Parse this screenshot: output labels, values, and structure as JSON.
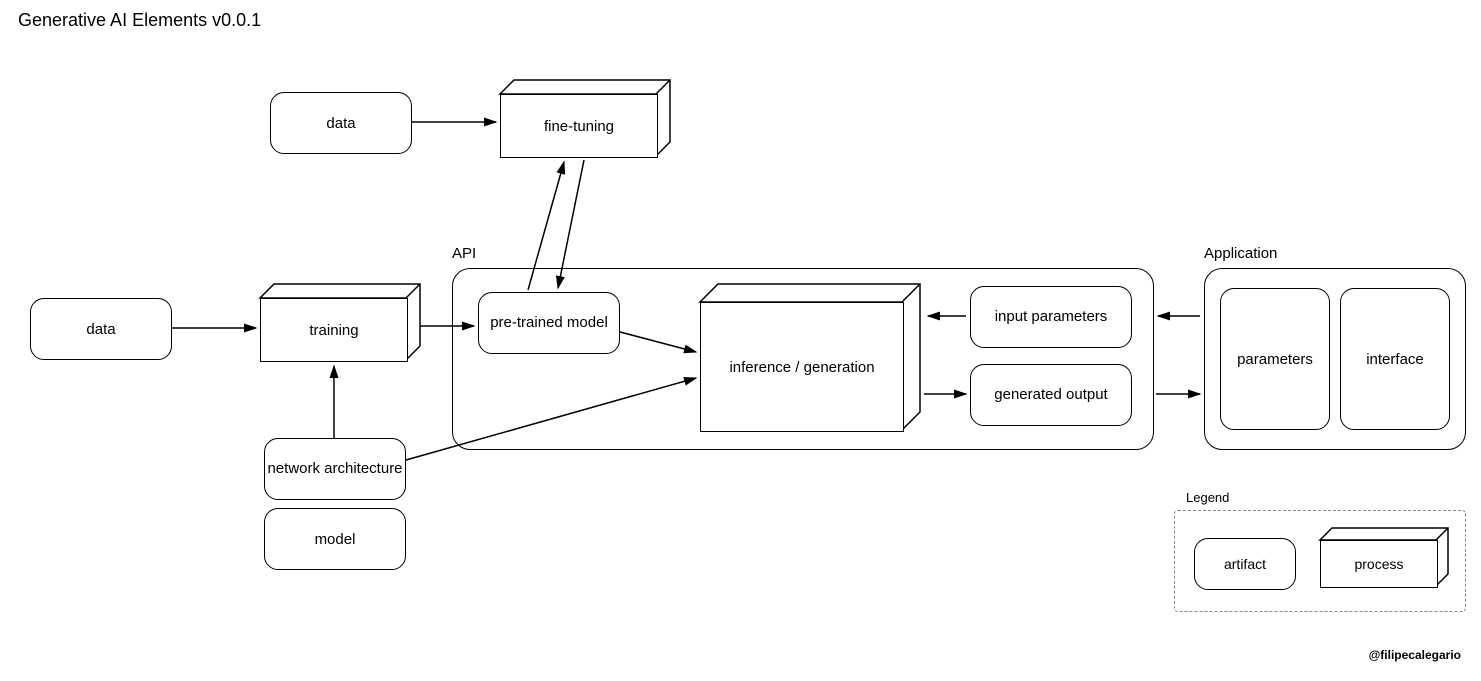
{
  "title": "Generative AI Elements v0.0.1",
  "credit": "@filipecalegario",
  "nodes": {
    "data1": "data",
    "data2": "data",
    "training": "training",
    "finetuning": "fine-tuning",
    "pretrained": "pre-trained model",
    "network": "network architecture",
    "model": "model",
    "inference": "inference / generation",
    "inputparams": "input parameters",
    "genoutput": "generated output",
    "parameters": "parameters",
    "interface": "interface"
  },
  "groups": {
    "api": "API",
    "application": "Application",
    "legend": "Legend"
  },
  "legend": {
    "artifact": "artifact",
    "process": "process"
  }
}
